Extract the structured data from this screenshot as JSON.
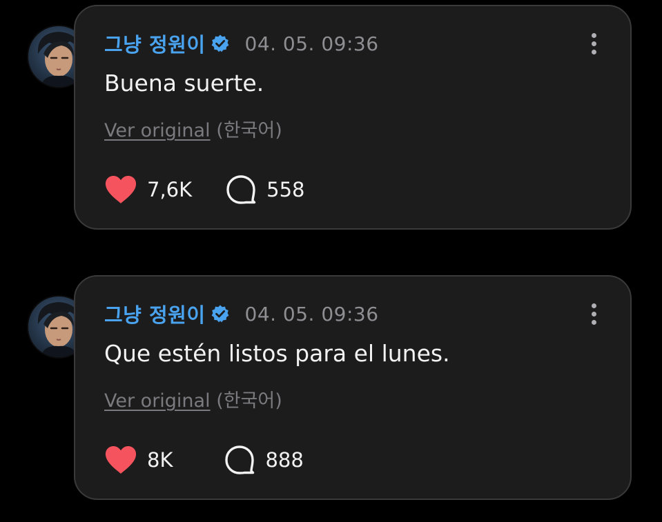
{
  "theme": {
    "background": "#000000",
    "bubble": "#1c1c1d",
    "username_color": "#4aa3ee",
    "like_color": "#f5535d",
    "muted_text": "#8e8e93"
  },
  "posts": [
    {
      "author": {
        "name": "그냥 정원이",
        "avatar_icon": "avatar-photo",
        "verified_icon": "verified-badge-icon"
      },
      "timestamp": "04. 05. 09:36",
      "message": "Buena suerte.",
      "translation": {
        "link_label": "Ver original",
        "language": "(한국어)"
      },
      "likes": "7,6K",
      "comments": "558"
    },
    {
      "author": {
        "name": "그냥 정원이",
        "avatar_icon": "avatar-photo",
        "verified_icon": "verified-badge-icon"
      },
      "timestamp": "04. 05. 09:36",
      "message": "Que estén listos para el lunes.",
      "translation": {
        "link_label": "Ver original",
        "language": "(한국어)"
      },
      "likes": "8K",
      "comments": "888"
    }
  ]
}
